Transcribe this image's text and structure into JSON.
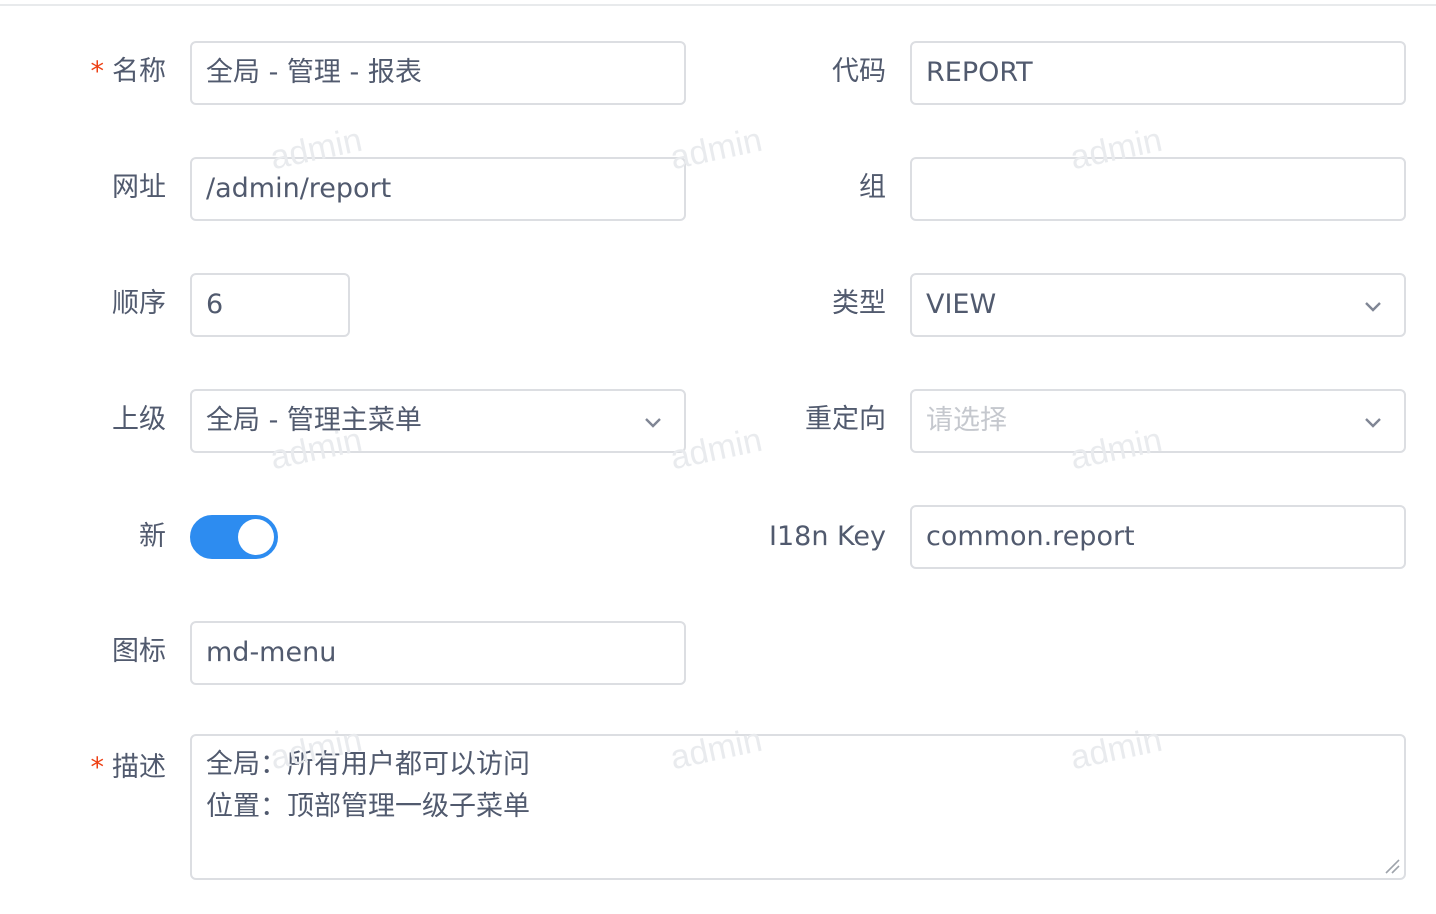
{
  "form": {
    "name": {
      "label": "名称",
      "required_mark": "*",
      "value": "全局 - 管理 - 报表"
    },
    "code": {
      "label": "代码",
      "value": "REPORT"
    },
    "url": {
      "label": "网址",
      "value": "/admin/report"
    },
    "group": {
      "label": "组",
      "value": ""
    },
    "order": {
      "label": "顺序",
      "value": "6"
    },
    "type": {
      "label": "类型",
      "value": "VIEW",
      "icon": "chevron-down-icon"
    },
    "parent": {
      "label": "上级",
      "value": "全局 - 管理主菜单",
      "icon": "chevron-down-icon"
    },
    "redirect": {
      "label": "重定向",
      "placeholder": "请选择",
      "icon": "chevron-down-icon"
    },
    "is_new": {
      "label": "新",
      "on": true,
      "color": "#2d8cf0"
    },
    "i18n": {
      "label": "I18n Key",
      "value": "common.report"
    },
    "icon": {
      "label": "图标",
      "value": "md-menu"
    },
    "description": {
      "label": "描述",
      "required_mark": "*",
      "lines": [
        "全局：所有用户都可以访问",
        "位置：顶部管理一级子菜单"
      ]
    }
  },
  "watermark": {
    "text": "admin"
  },
  "colors": {
    "required": "#ed4014",
    "border": "#dcdee2",
    "text": "#515a6e",
    "placeholder": "#c5c8ce",
    "primary": "#2d8cf0"
  }
}
